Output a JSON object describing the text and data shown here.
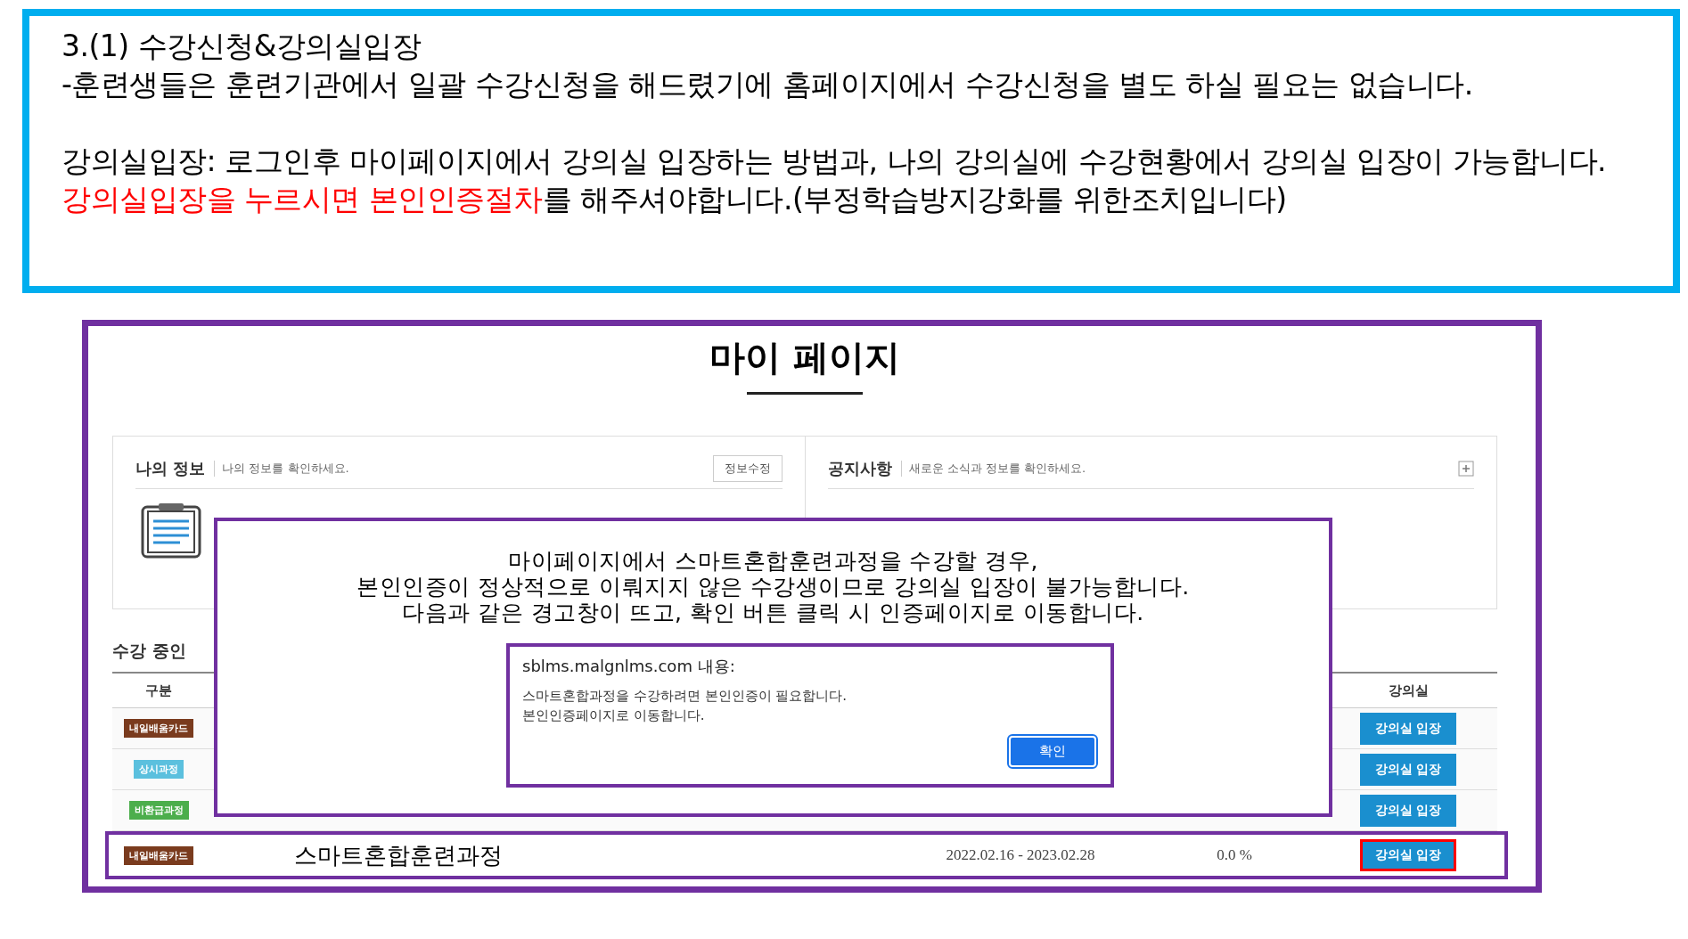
{
  "instructions": {
    "heading": "3.(1) 수강신청&강의실입장",
    "note": "-훈련생들은 훈련기관에서 일괄 수강신청을 해드렸기에 홈페이지에서 수강신청을 별도 하실 필요는 없습니다.",
    "entry_label": "강의실입장:",
    "entry_text": "로그인후 마이페이지에서 강의실 입장하는 방법과, 나의 강의실에 수강현황에서 강의실 입장이 가능합니다.",
    "warning_highlight": "강의실입장을 누르시면 본인인증절차",
    "warning_rest": "를 해주셔야합니다.(부정학습방지강화를 위한조치입니다)"
  },
  "screenshot": {
    "page_title": "마이 페이지",
    "info_panel": {
      "title": "나의 정보",
      "subtitle": "나의 정보를 확인하세요.",
      "button": "정보수정"
    },
    "notice_panel": {
      "title": "공지사항",
      "subtitle": "새로운 소식과 정보를 확인하세요."
    },
    "courses": {
      "title": "수강 중인",
      "columns": [
        {
          "label": "구분"
        },
        {
          "label": "강의실"
        }
      ],
      "rows": [
        {
          "badge": "내일배움카드",
          "color": "#7a3b1e",
          "button": "강의실 입장",
          "highlighted": false
        },
        {
          "badge": "상시과정",
          "color": "#5bc0de",
          "button": "강의실 입장",
          "highlighted": false
        },
        {
          "badge": "비환급과정",
          "color": "#4cae4c",
          "button": "강의실 입장",
          "highlighted": false
        },
        {
          "badge": "내일배움카드",
          "color": "#7a3b1e",
          "course": "스마트혼합훈련과정",
          "period": "2022.02.16 - 2023.02.28",
          "progress": "0.0 %",
          "button": "강의실 입장",
          "highlighted": true
        }
      ]
    },
    "callout": {
      "lines": [
        "마이페이지에서 스마트혼합훈련과정을 수강할 경우,",
        "본인인증이 정상적으로 이뤄지지 않은 수강생이므로 강의실 입장이 불가능합니다.",
        "다음과 같은 경고창이 뜨고, 확인 버튼 클릭 시 인증페이지로 이동합니다."
      ],
      "alert": {
        "origin": "sblms.malgnlms.com 내용:",
        "lines": [
          "스마트혼합과정을 수강하려면 본인인증이 필요합니다.",
          "본인인증페이지로 이동합니다."
        ],
        "button": "확인"
      }
    }
  }
}
